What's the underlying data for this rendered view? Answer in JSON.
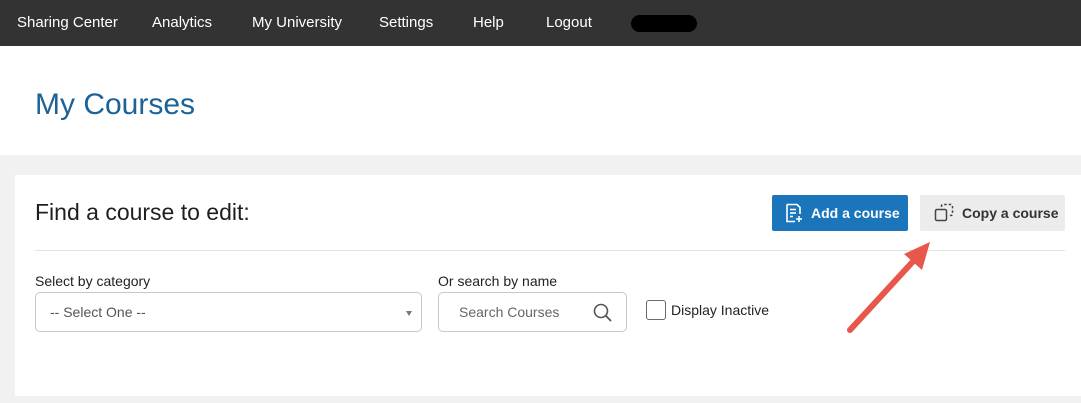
{
  "nav": {
    "items": [
      "Sharing Center",
      "Analytics",
      "My University",
      "Settings",
      "Help",
      "Logout"
    ]
  },
  "header": {
    "title": "My Courses"
  },
  "card": {
    "heading": "Find a course to edit:",
    "add_button": "Add a course",
    "copy_button": "Copy a course",
    "category_label": "Select by category",
    "category_value": "-- Select One --",
    "search_label": "Or search by name",
    "search_placeholder": "Search Courses",
    "inactive_label": "Display Inactive",
    "inactive_checked": false
  },
  "icons": {
    "add": "document-add-icon",
    "copy": "copy-icon",
    "search": "search-icon",
    "select": "chevron-down-icon"
  },
  "colors": {
    "nav_bg": "#333333",
    "title": "#1d6296",
    "primary": "#1b75bb",
    "secondary_bg": "#ececec",
    "annotation": "#e8574b"
  }
}
